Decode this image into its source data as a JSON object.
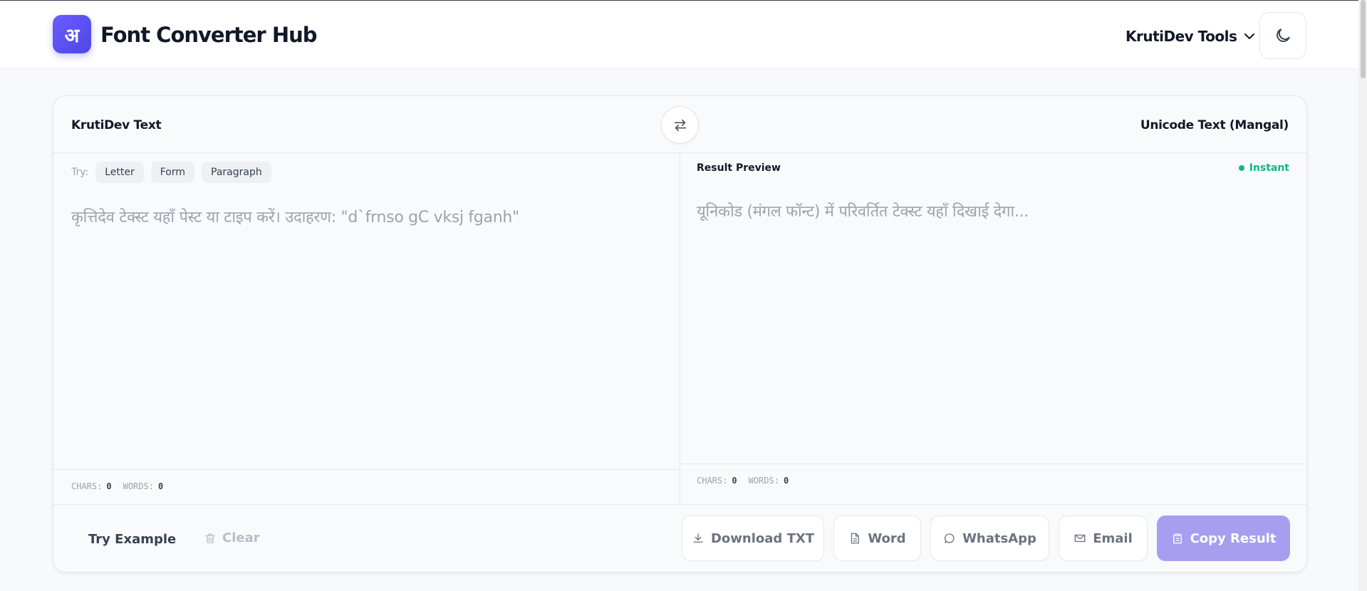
{
  "header": {
    "logo_glyph": "अ",
    "brand": "Font Converter Hub",
    "tools_menu_label": "KrutiDev Tools"
  },
  "converter": {
    "left_title": "KrutiDev Text",
    "right_title": "Unicode Text (Mangal)",
    "try_label": "Try:",
    "try_chips": [
      "Letter",
      "Form",
      "Paragraph"
    ],
    "input_placeholder": "कृत्तिदेव टेक्स्ट यहाँ पेस्ट या टाइप करें। उदाहरण: \"d`frnso gC vksj fganh\"",
    "result_label": "Result Preview",
    "instant_label": "Instant",
    "output_placeholder": "यूनिकोड (मंगल फॉन्ट) में परिवर्तित टेक्स्ट यहाँ दिखाई देगा...",
    "left_stats": {
      "chars_label": "CHARS:",
      "chars": "0",
      "words_label": "WORDS:",
      "words": "0"
    },
    "right_stats": {
      "chars_label": "CHARS:",
      "chars": "0",
      "words_label": "WORDS:",
      "words": "0"
    }
  },
  "footer": {
    "try_example": "Try Example",
    "clear": "Clear",
    "download_txt": "Download TXT",
    "word": "Word",
    "whatsapp": "WhatsApp",
    "email": "Email",
    "copy_result": "Copy Result"
  },
  "colors": {
    "brand_accent": "#4f46e5",
    "copy_button": "#a89ef0",
    "instant_green": "#10b981"
  }
}
